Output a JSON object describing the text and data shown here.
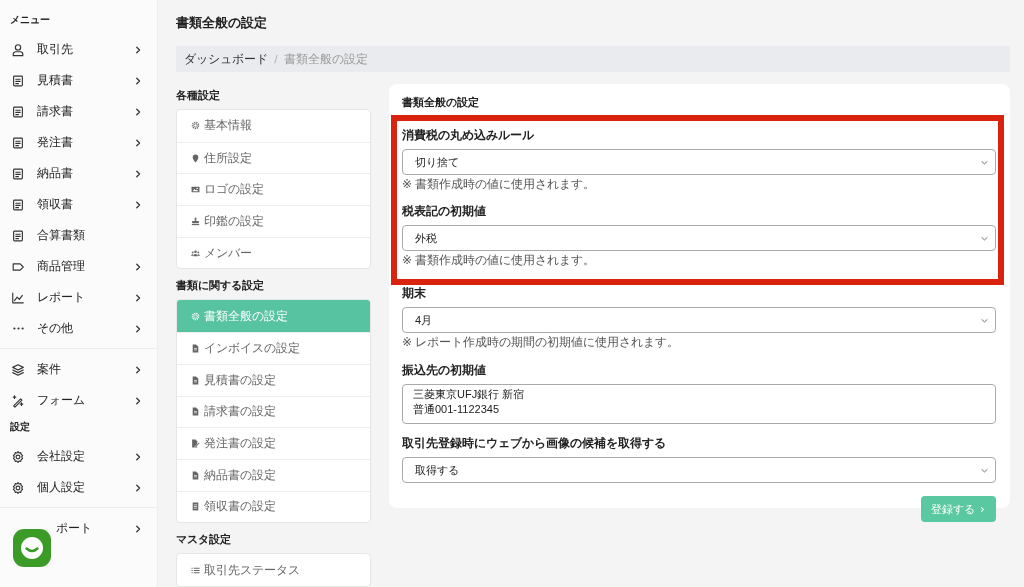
{
  "sidebar": {
    "sections": [
      {
        "heading": "メニュー",
        "items": [
          {
            "label": "取引先",
            "kind": "person",
            "has_submenu": true
          },
          {
            "label": "見積書",
            "kind": "document",
            "has_submenu": true
          },
          {
            "label": "請求書",
            "kind": "document",
            "has_submenu": true
          },
          {
            "label": "発注書",
            "kind": "document",
            "has_submenu": true
          },
          {
            "label": "納品書",
            "kind": "document",
            "has_submenu": true
          },
          {
            "label": "領収書",
            "kind": "document",
            "has_submenu": true
          },
          {
            "label": "合算書類",
            "kind": "document",
            "has_submenu": false
          },
          {
            "label": "商品管理",
            "kind": "tag",
            "has_submenu": true
          },
          {
            "label": "レポート",
            "kind": "chart",
            "has_submenu": true
          },
          {
            "label": "その他",
            "kind": "dots",
            "has_submenu": true
          }
        ]
      },
      {
        "items": [
          {
            "label": "案件",
            "kind": "layers",
            "has_submenu": true
          },
          {
            "label": "フォーム",
            "kind": "wand",
            "has_submenu": true
          }
        ]
      },
      {
        "heading": "設定",
        "items": [
          {
            "label": "会社設定",
            "kind": "gear",
            "has_submenu": true
          },
          {
            "label": "個人設定",
            "kind": "gear",
            "has_submenu": true
          }
        ]
      },
      {
        "items": [
          {
            "label": "ポート",
            "kind": "covered",
            "has_submenu": true
          }
        ]
      }
    ]
  },
  "page": {
    "title": "書類全般の設定",
    "breadcrumb": [
      {
        "label": "ダッシュボード",
        "current": false
      },
      {
        "label": "書類全般の設定",
        "current": true
      }
    ]
  },
  "settings_nav": [
    {
      "heading": "各種設定",
      "items": [
        {
          "label": "基本情報",
          "kind": "gear",
          "selected": false
        },
        {
          "label": "住所設定",
          "kind": "pin",
          "selected": false
        },
        {
          "label": "ロゴの設定",
          "kind": "image",
          "selected": false
        },
        {
          "label": "印鑑の設定",
          "kind": "stamp",
          "selected": false
        },
        {
          "label": "メンバー",
          "kind": "users",
          "selected": false
        }
      ]
    },
    {
      "heading": "書類に関する設定",
      "items": [
        {
          "label": "書類全般の設定",
          "kind": "gear",
          "selected": true
        },
        {
          "label": "インボイスの設定",
          "kind": "file",
          "selected": false
        },
        {
          "label": "見積書の設定",
          "kind": "file",
          "selected": false
        },
        {
          "label": "請求書の設定",
          "kind": "file",
          "selected": false
        },
        {
          "label": "発注書の設定",
          "kind": "file-pen",
          "selected": false
        },
        {
          "label": "納品書の設定",
          "kind": "file",
          "selected": false
        },
        {
          "label": "領収書の設定",
          "kind": "receipt",
          "selected": false
        }
      ]
    },
    {
      "heading": "マスタ設定",
      "items": [
        {
          "label": "取引先ステータス",
          "kind": "list",
          "selected": false
        }
      ]
    }
  ],
  "form": {
    "title": "書類全般の設定",
    "fields": [
      {
        "kind": "select",
        "label": "消費税の丸め込みルール",
        "value": "切り捨て",
        "note": "※ 書類作成時の値に使用されます。",
        "highlighted": true
      },
      {
        "kind": "select",
        "label": "税表記の初期値",
        "value": "外税",
        "note": "※ 書類作成時の値に使用されます。",
        "highlighted": true
      },
      {
        "kind": "select",
        "label": "期末",
        "value": "4月",
        "note": "※ レポート作成時の期間の初期値に使用されます。",
        "highlighted": false
      },
      {
        "kind": "textarea",
        "label": "振込先の初期値",
        "lines": [
          "三菱東京UFJ銀行 新宿",
          "普通001-1122345"
        ],
        "highlighted": false
      },
      {
        "kind": "select",
        "label": "取引先登録時にウェブから画像の候補を取得する",
        "value": "取得する",
        "highlighted": false
      }
    ],
    "submit": "登録する"
  }
}
